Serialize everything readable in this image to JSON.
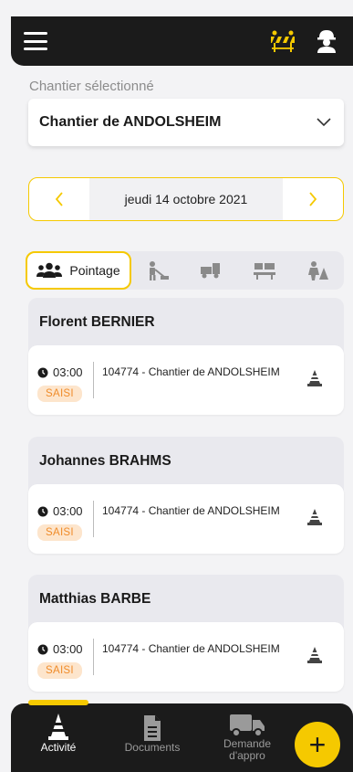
{
  "header": {
    "menu_icon": "hamburger-icon",
    "icons": [
      "construction-barrier-icon",
      "worker-avatar-icon"
    ],
    "accent": "#f5c900"
  },
  "chantier": {
    "label": "Chantier sélectionné",
    "value": "Chantier de ANDOLSHEIM"
  },
  "date": {
    "value": "jeudi 14 octobre 2021"
  },
  "tabs": {
    "active_label": "Pointage",
    "icons": [
      "workers-icon",
      "worker-digging-icon",
      "truck-icon",
      "barrier-icon",
      "road-worker-icon"
    ]
  },
  "persons": [
    {
      "name": "Florent BERNIER",
      "time": "03:00",
      "status": "SAISI",
      "site": "104774 - Chantier de ANDOLSHEIM"
    },
    {
      "name": "Johannes BRAHMS",
      "time": "03:00",
      "status": "SAISI",
      "site": "104774 - Chantier de ANDOLSHEIM"
    },
    {
      "name": "Matthias BARBE",
      "time": "03:00",
      "status": "SAISI",
      "site": "104774 - Chantier de ANDOLSHEIM"
    }
  ],
  "nav": {
    "items": [
      {
        "label": "Activité",
        "icon": "cone-icon",
        "active": true
      },
      {
        "label": "Documents",
        "icon": "document-icon",
        "active": false
      },
      {
        "label": "Demande d'appro",
        "icon": "truck-icon",
        "active": false
      }
    ],
    "fab_label": "+"
  }
}
